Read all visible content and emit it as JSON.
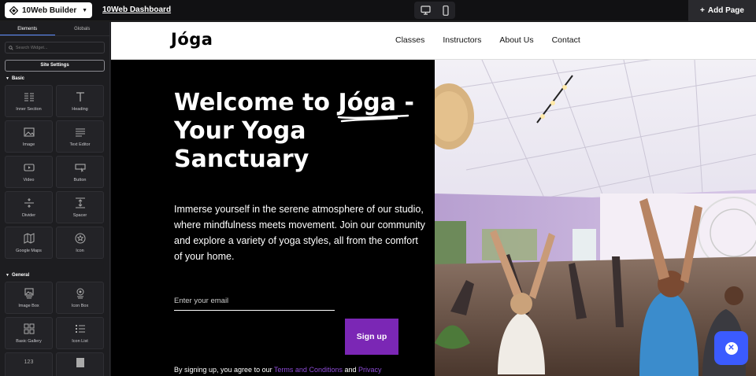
{
  "topbar": {
    "builder_label": "10Web Builder",
    "dashboard_link": "10Web Dashboard",
    "add_page_label": "Add Page"
  },
  "sidebar": {
    "tabs": [
      "Elements",
      "Globals"
    ],
    "search_placeholder": "Search Widget...",
    "site_settings": "Site Settings",
    "sections": {
      "basic": "Basic",
      "general": "General"
    },
    "basic_widgets": [
      "Inner Section",
      "Heading",
      "Image",
      "Text Editor",
      "Video",
      "Button",
      "Divider",
      "Spacer",
      "Google Maps",
      "Icon"
    ],
    "general_widgets": [
      "Image Box",
      "Icon Box",
      "Basic Gallery",
      "Icon List"
    ],
    "partial_icon_text": "123"
  },
  "site": {
    "logo": "Jóga",
    "menu": [
      "Classes",
      "Instructors",
      "About Us",
      "Contact"
    ],
    "hero": {
      "title_prefix": "Welcome to ",
      "title_brand": "Jóga",
      "title_suffix": " - Your Yoga Sanctuary",
      "description": "Immerse yourself in the serene atmosphere of our studio, where mindfulness meets movement. Join our community and explore a variety of yoga styles, all from the comfort of your home.",
      "email_placeholder": "Enter your email",
      "signup_label": "Sign up",
      "fine_print_prefix": "By signing up, you agree to our ",
      "terms_link": "Terms and Conditions",
      "fine_print_and": " and ",
      "privacy_link": "Privacy"
    }
  },
  "colors": {
    "accent": "#7b27b5",
    "fab": "#3b5bff",
    "sidebar_bg": "#1d1d20"
  }
}
